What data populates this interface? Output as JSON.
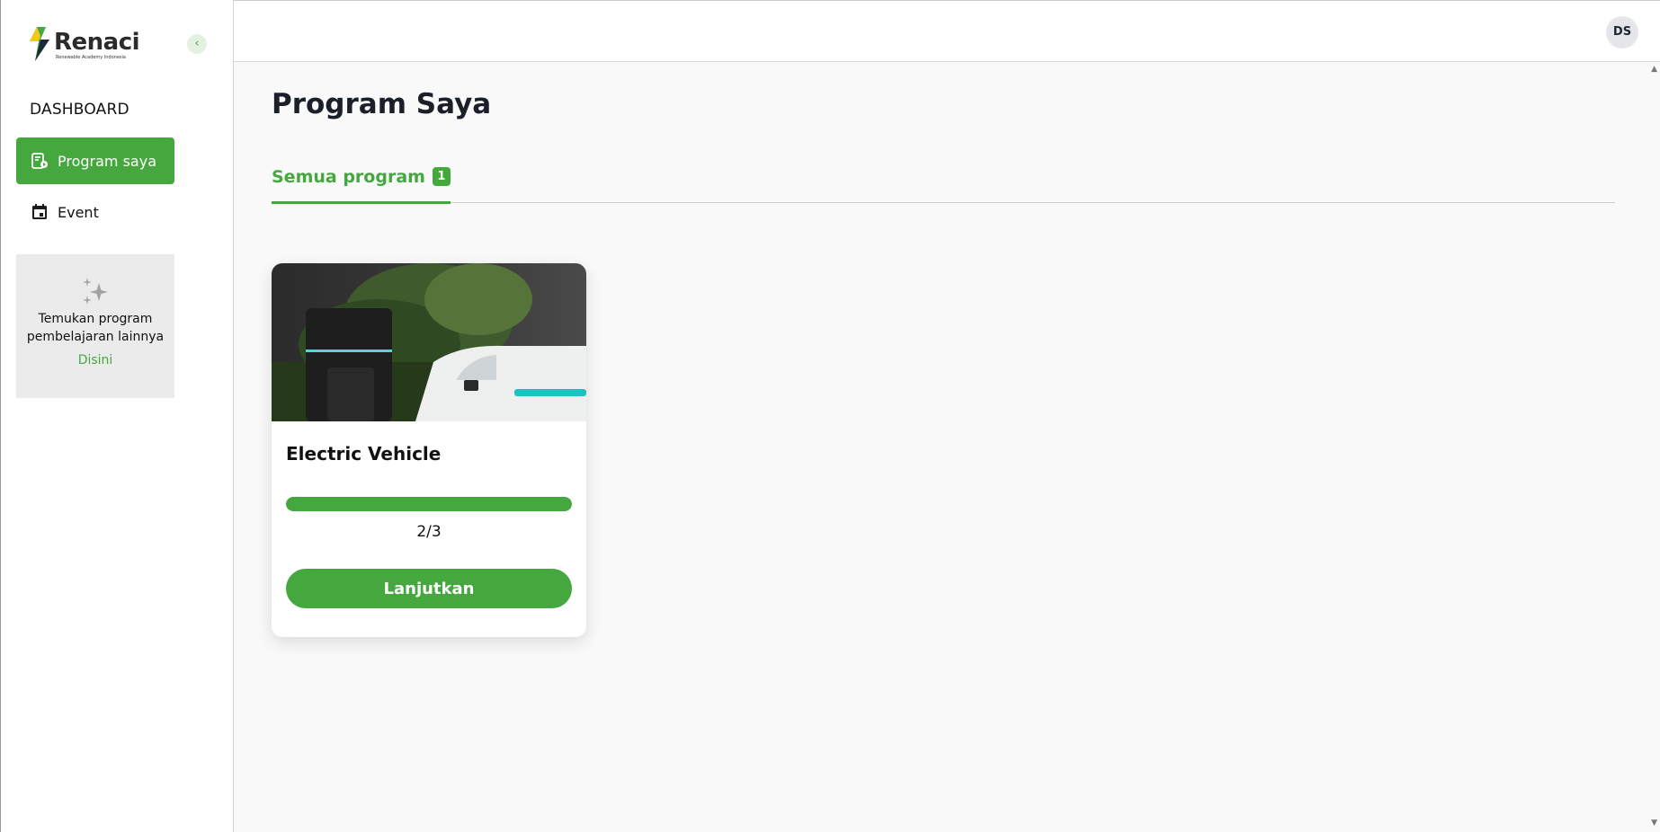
{
  "brand": {
    "name": "Renaci",
    "tagline": "Renewable Academy Indonesia",
    "accent_color": "#45a83e"
  },
  "sidebar": {
    "collapse_icon": "chevron-left-icon",
    "section_title": "DASHBOARD",
    "items": [
      {
        "label": "Program saya",
        "icon": "program-icon",
        "active": true
      },
      {
        "label": "Event",
        "icon": "calendar-icon",
        "active": false
      }
    ],
    "promo": {
      "icon": "sparkle-icon",
      "text": "Temukan program pembelajaran lainnya",
      "link": "Disini"
    }
  },
  "header": {
    "avatar_initials": "DS"
  },
  "main": {
    "title": "Program Saya",
    "tabs": [
      {
        "label": "Semua program",
        "count": "1",
        "active": true
      }
    ],
    "programs": [
      {
        "title": "Electric Vehicle",
        "progress_text": "2/3",
        "progress_fraction": 1.0,
        "button_label": "Lanjutkan"
      }
    ]
  }
}
